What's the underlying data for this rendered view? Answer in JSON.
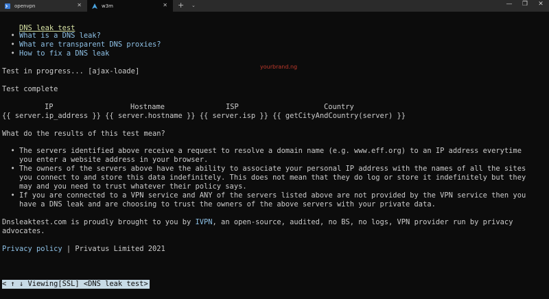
{
  "tabs": [
    {
      "label": "openvpn",
      "active": false
    },
    {
      "label": "w3m",
      "active": true
    }
  ],
  "window": {
    "new_tab": "+",
    "tab_menu": "⌄",
    "minimize": "—",
    "maximize": "❐",
    "close": "✕"
  },
  "page": {
    "title_link": "DNS leak test",
    "nav_links": [
      "What is a DNS leak?",
      "What are transparent DNS proxies?",
      "How to fix a DNS leak"
    ],
    "progress_text": "Test in progress...",
    "progress_placeholder": "[ajax-loade]",
    "watermark": "yourbrand.ng",
    "complete_text": "Test complete",
    "table_headers": [
      "IP",
      "Hostname",
      "ISP",
      "Country"
    ],
    "table_row": "{{ server.ip_address }} {{ server.hostname }} {{ server.isp }} {{ getCityAndCountry(server) }}",
    "question": "What do the results of this test mean?",
    "bullets": [
      [
        "The servers identified above receive a request to resolve a domain name (e.g. www.eff.org) to an IP address everytime",
        "you enter a website address in your browser."
      ],
      [
        "The owners of the servers above have the ability to associate your personal IP address with the names of all the sites",
        "you connect to and store this data indefinitely. This does not mean that they do log or store it indefinitely but they",
        "may and you need to trust whatever their policy says."
      ],
      [
        "If you are connected to a VPN service and ANY of the servers listed above are not provided by the VPN service then you",
        "have a DNS leak and are choosing to trust the owners of the above servers with your private data."
      ]
    ],
    "footer_prefix": "Dnsleaktest.com is proudly brought to you by ",
    "footer_link": "IVPN",
    "footer_suffix": ", an open-source, audited, no BS, no logs, VPN provider run by privacy",
    "footer_line2": "advocates.",
    "privacy_link": "Privacy policy",
    "copyright": " | Privatus Limited 2021"
  },
  "status_bar": "< ↑ ↓ Viewing[SSL] <DNS leak test>",
  "colors": {
    "background": "#0c0c0c",
    "text": "#cccccc",
    "link": "#8ec1e6",
    "title": "#d8e3a4",
    "status_bg": "#c8dbe6"
  }
}
